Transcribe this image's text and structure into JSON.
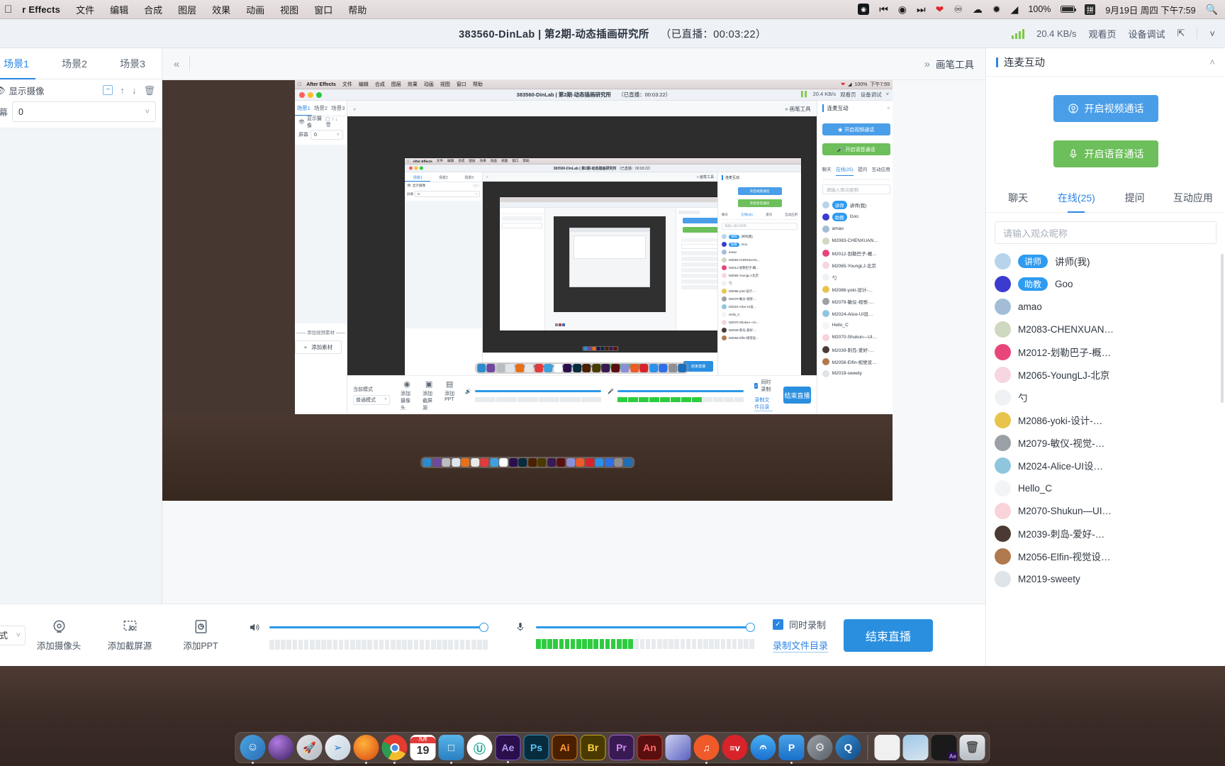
{
  "macbar": {
    "apple_icon": "apple-logo",
    "app_name": "r Effects",
    "menus": [
      "文件",
      "编辑",
      "合成",
      "图层",
      "效果",
      "动画",
      "视图",
      "窗口",
      "帮助"
    ],
    "status_icons": [
      "screen-record-icon",
      "prev-track-icon",
      "play-circle-icon",
      "next-track-icon",
      "heart-icon",
      "creative-cloud-icon",
      "cloud-upload-icon",
      "bluetooth-icon",
      "wifi-icon"
    ],
    "battery_percent": "100%",
    "input_method": "拼",
    "datetime": "9月19日 周四 下午7:59",
    "search_icon": "spotlight-search-icon"
  },
  "app": {
    "title": "383560-DinLab | 第2期-动态插画研究所",
    "duration": "（已直播：00:03:22）",
    "header_right": {
      "bitrate": "20.4 KB/s",
      "watch_page": "观看页",
      "device_test": "设备调试",
      "expand_icon": "expand-icon",
      "collapse_icon": "chevron-down-icon"
    }
  },
  "left": {
    "tabs": [
      {
        "label": "场景1",
        "active": true
      },
      {
        "label": "场景2",
        "active": false
      },
      {
        "label": "场景3",
        "active": false
      }
    ],
    "layer_row": {
      "eye_icon": "eye-icon",
      "label": "显示摄像",
      "tools": [
        "minus-box-icon",
        "arrow-up-icon",
        "arrow-down-icon",
        "trash-icon"
      ]
    },
    "screen_label": "屏幕",
    "screen_value": "0",
    "add_video_divider": "添加视频素材",
    "add_material_button": "添加素材"
  },
  "center": {
    "collapse_icon": "chevrons-left-icon",
    "brush_tool": "画笔工具",
    "brush_icon": "chevrons-right-icon"
  },
  "nested": {
    "app_name": "After Effects",
    "menus": [
      "文件",
      "编辑",
      "合成",
      "图层",
      "效果",
      "动画",
      "视图",
      "窗口",
      "帮助"
    ],
    "title": "383560-DinLab | 第2期-动态插画研究所",
    "duration": "（已直播：00:03:22）",
    "tabs": [
      "场景1",
      "场景2",
      "场景3"
    ],
    "layer_label": "显示摄像",
    "screen_label": "屏幕",
    "screen_value": "0",
    "brush_tool": "画笔工具",
    "bitrate": "20.4 KB/s",
    "watch_page": "观看页",
    "device_test": "设备调试",
    "panel_title": "连麦互动",
    "video_call": "开启视频通话",
    "voice_call": "开启语音通话",
    "rtabs": [
      "聊天",
      "在线(25)",
      "提问",
      "互动应用"
    ],
    "search_placeholder": "请输入观众昵称",
    "add_video_divider": "添加视频素材",
    "add_material_button": "添加素材",
    "mode_label": "当前模式",
    "mode_value": "普通模式",
    "src_camera": "添加摄像头",
    "src_screen": "添加截屏源",
    "src_ppt": "添加PPT",
    "record_checkbox": "同时录制",
    "record_dir": "录制文件目录",
    "end_button": "结束直播",
    "users": [
      "讲师(我)",
      "Goo",
      "amao",
      "M2083-CHENXUAN…",
      "M2012-划勒巴子-概…",
      "M2065-YoungLJ-北京",
      "勺",
      "M2086-yoki-设计-…",
      "M2079-敏仪-视觉-…",
      "M2024-Alice-UI设…",
      "Hello_C",
      "M2070-Shukun—UI…",
      "M2039-刺岛-爱好-…",
      "M2056-Elfin-视觉设…",
      "M2019-sweety"
    ]
  },
  "right": {
    "panel_title": "连麦互动",
    "collapse_icon": "chevron-up-icon",
    "video_call": {
      "label": "开启视频通话",
      "icon": "camera-icon",
      "color": "#4a9ee8"
    },
    "voice_call": {
      "label": "开启语音通话",
      "icon": "microphone-icon",
      "color": "#6cbf5a"
    },
    "tabs": [
      {
        "label": "聊天",
        "active": false
      },
      {
        "label": "在线(25)",
        "active": true
      },
      {
        "label": "提问",
        "active": false
      },
      {
        "label": "互动应用",
        "active": false
      }
    ],
    "search_placeholder": "请输入观众昵称",
    "users": [
      {
        "tag": "讲师",
        "name": "讲师(我)",
        "avatar_color": "#b7d4ea"
      },
      {
        "tag": "助教",
        "name": "Goo",
        "avatar_color": "#3b3bd0"
      },
      {
        "tag": "",
        "name": "amao",
        "avatar_color": "#a3bdd6"
      },
      {
        "tag": "",
        "name": "M2083-CHENXUAN…",
        "avatar_color": "#cfd8c0"
      },
      {
        "tag": "",
        "name": "M2012-划勒巴子-概…",
        "avatar_color": "#e8457a"
      },
      {
        "tag": "",
        "name": "M2065-YoungLJ-北京",
        "avatar_color": "#f6d6e0"
      },
      {
        "tag": "",
        "name": "勺",
        "avatar_color": "#eef2f4"
      },
      {
        "tag": "",
        "name": "M2086-yoki-设计-…",
        "avatar_color": "#e8c44d"
      },
      {
        "tag": "",
        "name": "M2079-敏仪-视觉-…",
        "avatar_color": "#9aa0a5"
      },
      {
        "tag": "",
        "name": "M2024-Alice-UI设…",
        "avatar_color": "#8fc6de"
      },
      {
        "tag": "",
        "name": "Hello_C",
        "avatar_color": "#f3f4f5"
      },
      {
        "tag": "",
        "name": "M2070-Shukun—UI…",
        "avatar_color": "#f9d3da"
      },
      {
        "tag": "",
        "name": "M2039-刺岛-爱好-…",
        "avatar_color": "#4a3a33"
      },
      {
        "tag": "",
        "name": "M2056-Elfin-视觉设…",
        "avatar_color": "#b07a4e"
      },
      {
        "tag": "",
        "name": "M2019-sweety",
        "avatar_color": "#dfe4e8"
      }
    ]
  },
  "bottom": {
    "mode_label": "当前模式",
    "mode_value": "普通模式",
    "sources": [
      {
        "label": "添加摄像头",
        "icon": "camera-icon"
      },
      {
        "label": "添加截屏源",
        "icon": "screen-capture-icon"
      },
      {
        "label": "添加PPT",
        "icon": "ppt-icon"
      }
    ],
    "speaker_icon": "speaker-icon",
    "mic_icon": "microphone-icon",
    "speaker_volume": 100,
    "mic_volume": 100,
    "mic_level_segments": 17,
    "record_checkbox_label": "同时录制",
    "record_checkbox_checked": true,
    "record_dir_link": "录制文件目录",
    "end_stream_button": "结束直播",
    "accent_color": "#2b8fe0"
  },
  "dock": {
    "items": [
      {
        "name": "finder",
        "label": "",
        "color": "#2b8ccd",
        "shape": "round"
      },
      {
        "name": "siri",
        "label": "",
        "color": "#6e4a9e",
        "shape": "round"
      },
      {
        "name": "launchpad",
        "label": "",
        "color": "#c9ccd1",
        "shape": "round"
      },
      {
        "name": "safari",
        "label": "",
        "color": "#dfe6ec",
        "shape": "round"
      },
      {
        "name": "firefox",
        "label": "",
        "color": "#e8701a",
        "shape": "round"
      },
      {
        "name": "chrome",
        "label": "",
        "color": "#e8e8e8",
        "shape": "round"
      },
      {
        "name": "calendar",
        "label": "19",
        "color": "#ffffff",
        "shape": "square"
      },
      {
        "name": "keynote",
        "label": "",
        "color": "#3fa0dc",
        "shape": "square"
      },
      {
        "name": "wondershare",
        "label": "Ⓤ",
        "color": "#ffffff",
        "shape": "round"
      },
      {
        "name": "after-effects",
        "label": "Ae",
        "color": "#2b0f4d",
        "shape": "square"
      },
      {
        "name": "photoshop",
        "label": "Ps",
        "color": "#062c3e",
        "shape": "square"
      },
      {
        "name": "illustrator",
        "label": "Ai",
        "color": "#4a2000",
        "shape": "square"
      },
      {
        "name": "bridge",
        "label": "Br",
        "color": "#4a3a00",
        "shape": "square"
      },
      {
        "name": "premiere",
        "label": "Pr",
        "color": "#3a1a52",
        "shape": "square"
      },
      {
        "name": "animate",
        "label": "An",
        "color": "#5a0f0f",
        "shape": "square"
      },
      {
        "name": "procreate",
        "label": "",
        "color": "#8a90d8",
        "shape": "square"
      },
      {
        "name": "cctalk",
        "label": "",
        "color": "#f05a28",
        "shape": "round"
      },
      {
        "name": "evernote",
        "label": "≡v",
        "color": "#d8232a",
        "shape": "round"
      },
      {
        "name": "app-store",
        "label": "",
        "color": "#2d8fe8",
        "shape": "round"
      },
      {
        "name": "pages",
        "label": "P",
        "color": "#2d8fe8",
        "shape": "square"
      },
      {
        "name": "system-preferences",
        "label": "",
        "color": "#8e8e93",
        "shape": "round"
      },
      {
        "name": "quicktime",
        "label": "",
        "color": "#1d6fb8",
        "shape": "round"
      }
    ],
    "recent": [
      {
        "name": "document",
        "color": "#f0f0f0"
      },
      {
        "name": "screenshot",
        "color": "#a8c8e0"
      },
      {
        "name": "ae-project",
        "color": "#1a1a1a"
      },
      {
        "name": "trash",
        "color": "#cfd4d8"
      }
    ]
  }
}
